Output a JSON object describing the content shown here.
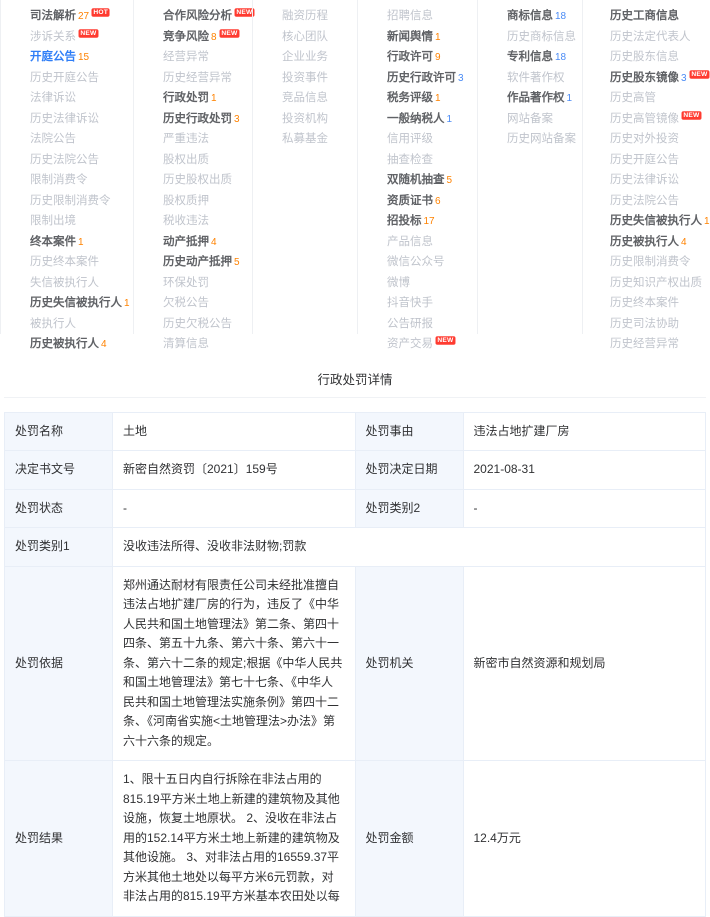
{
  "menu": {
    "columns": [
      {
        "id": "judicial",
        "items": [
          {
            "label": "司法解析",
            "count": "27",
            "count_color": "orange",
            "state": "active",
            "badge": "HOT"
          },
          {
            "label": "涉诉关系",
            "count": "",
            "state": "dim",
            "badge": "NEW"
          },
          {
            "label": "开庭公告",
            "count": "15",
            "count_color": "orange",
            "state": "selected",
            "badge": ""
          },
          {
            "label": "历史开庭公告",
            "count": "",
            "state": "dim",
            "badge": ""
          },
          {
            "label": "法律诉讼",
            "count": "",
            "state": "dim",
            "badge": ""
          },
          {
            "label": "历史法律诉讼",
            "count": "",
            "state": "dim",
            "badge": ""
          },
          {
            "label": "法院公告",
            "count": "",
            "state": "dim",
            "badge": ""
          },
          {
            "label": "历史法院公告",
            "count": "",
            "state": "dim",
            "badge": ""
          },
          {
            "label": "限制消费令",
            "count": "",
            "state": "dim",
            "badge": ""
          },
          {
            "label": "历史限制消费令",
            "count": "",
            "state": "dim",
            "badge": ""
          },
          {
            "label": "限制出境",
            "count": "",
            "state": "dim",
            "badge": ""
          },
          {
            "label": "终本案件",
            "count": "1",
            "count_color": "orange",
            "state": "active",
            "badge": ""
          },
          {
            "label": "历史终本案件",
            "count": "",
            "state": "dim",
            "badge": ""
          },
          {
            "label": "失信被执行人",
            "count": "",
            "state": "dim",
            "badge": ""
          },
          {
            "label": "历史失信被执行人",
            "count": "1",
            "count_color": "orange",
            "state": "active",
            "badge": ""
          },
          {
            "label": "被执行人",
            "count": "",
            "state": "dim",
            "badge": ""
          },
          {
            "label": "历史被执行人",
            "count": "4",
            "count_color": "orange",
            "state": "active",
            "badge": ""
          }
        ]
      },
      {
        "id": "risk",
        "items": [
          {
            "label": "合作风险分析",
            "count": "",
            "state": "active",
            "badge": "NEW"
          },
          {
            "label": "竞争风险",
            "count": "8",
            "count_color": "orange",
            "state": "active",
            "badge": "NEW"
          },
          {
            "label": "经营异常",
            "count": "",
            "state": "dim",
            "badge": ""
          },
          {
            "label": "历史经营异常",
            "count": "",
            "state": "dim",
            "badge": ""
          },
          {
            "label": "行政处罚",
            "count": "1",
            "count_color": "orange",
            "state": "active",
            "badge": ""
          },
          {
            "label": "历史行政处罚",
            "count": "3",
            "count_color": "orange",
            "state": "active",
            "badge": ""
          },
          {
            "label": "严重违法",
            "count": "",
            "state": "dim",
            "badge": ""
          },
          {
            "label": "股权出质",
            "count": "",
            "state": "dim",
            "badge": ""
          },
          {
            "label": "历史股权出质",
            "count": "",
            "state": "dim",
            "badge": ""
          },
          {
            "label": "股权质押",
            "count": "",
            "state": "dim",
            "badge": ""
          },
          {
            "label": "税收违法",
            "count": "",
            "state": "dim",
            "badge": ""
          },
          {
            "label": "动产抵押",
            "count": "4",
            "count_color": "orange",
            "state": "active",
            "badge": ""
          },
          {
            "label": "历史动产抵押",
            "count": "5",
            "count_color": "orange",
            "state": "active",
            "badge": ""
          },
          {
            "label": "环保处罚",
            "count": "",
            "state": "dim",
            "badge": ""
          },
          {
            "label": "欠税公告",
            "count": "",
            "state": "dim",
            "badge": ""
          },
          {
            "label": "历史欠税公告",
            "count": "",
            "state": "dim",
            "badge": ""
          },
          {
            "label": "清算信息",
            "count": "",
            "state": "dim",
            "badge": ""
          }
        ]
      },
      {
        "id": "investment",
        "items": [
          {
            "label": "融资历程",
            "count": "",
            "state": "dim",
            "badge": ""
          },
          {
            "label": "核心团队",
            "count": "",
            "state": "dim",
            "badge": ""
          },
          {
            "label": "企业业务",
            "count": "",
            "state": "dim",
            "badge": ""
          },
          {
            "label": "投资事件",
            "count": "",
            "state": "dim",
            "badge": ""
          },
          {
            "label": "竞品信息",
            "count": "",
            "state": "dim",
            "badge": ""
          },
          {
            "label": "投资机构",
            "count": "",
            "state": "dim",
            "badge": ""
          },
          {
            "label": "私募基金",
            "count": "",
            "state": "dim",
            "badge": ""
          }
        ]
      },
      {
        "id": "operation",
        "items": [
          {
            "label": "招聘信息",
            "count": "",
            "state": "dim",
            "badge": ""
          },
          {
            "label": "新闻舆情",
            "count": "1",
            "count_color": "orange",
            "state": "active",
            "badge": ""
          },
          {
            "label": "行政许可",
            "count": "9",
            "count_color": "orange",
            "state": "active",
            "badge": ""
          },
          {
            "label": "历史行政许可",
            "count": "3",
            "count_color": "blue",
            "state": "active",
            "badge": ""
          },
          {
            "label": "税务评级",
            "count": "1",
            "count_color": "orange",
            "state": "active",
            "badge": ""
          },
          {
            "label": "一般纳税人",
            "count": "1",
            "count_color": "blue",
            "state": "active",
            "badge": ""
          },
          {
            "label": "信用评级",
            "count": "",
            "state": "dim",
            "badge": ""
          },
          {
            "label": "抽查检查",
            "count": "",
            "state": "dim",
            "badge": ""
          },
          {
            "label": "双随机抽查",
            "count": "5",
            "count_color": "orange",
            "state": "active",
            "badge": ""
          },
          {
            "label": "资质证书",
            "count": "6",
            "count_color": "orange",
            "state": "active",
            "badge": ""
          },
          {
            "label": "招投标",
            "count": "17",
            "count_color": "orange",
            "state": "active",
            "badge": ""
          },
          {
            "label": "产品信息",
            "count": "",
            "state": "dim",
            "badge": ""
          },
          {
            "label": "微信公众号",
            "count": "",
            "state": "dim",
            "badge": ""
          },
          {
            "label": "微博",
            "count": "",
            "state": "dim",
            "badge": ""
          },
          {
            "label": "抖音快手",
            "count": "",
            "state": "dim",
            "badge": ""
          },
          {
            "label": "公告研报",
            "count": "",
            "state": "dim",
            "badge": ""
          },
          {
            "label": "资产交易",
            "count": "",
            "state": "dim",
            "badge": "NEW"
          }
        ]
      },
      {
        "id": "ip",
        "items": [
          {
            "label": "商标信息",
            "count": "18",
            "count_color": "blue",
            "state": "active",
            "badge": ""
          },
          {
            "label": "历史商标信息",
            "count": "",
            "state": "dim",
            "badge": ""
          },
          {
            "label": "专利信息",
            "count": "18",
            "count_color": "blue",
            "state": "active",
            "badge": ""
          },
          {
            "label": "软件著作权",
            "count": "",
            "state": "dim",
            "badge": ""
          },
          {
            "label": "作品著作权",
            "count": "1",
            "count_color": "blue",
            "state": "active",
            "badge": ""
          },
          {
            "label": "网站备案",
            "count": "",
            "state": "dim",
            "badge": ""
          },
          {
            "label": "历史网站备案",
            "count": "",
            "state": "dim",
            "badge": ""
          }
        ]
      },
      {
        "id": "history",
        "items": [
          {
            "label": "历史工商信息",
            "count": "",
            "state": "active",
            "badge": ""
          },
          {
            "label": "历史法定代表人",
            "count": "",
            "state": "dim",
            "badge": ""
          },
          {
            "label": "历史股东信息",
            "count": "",
            "state": "dim",
            "badge": ""
          },
          {
            "label": "历史股东镜像",
            "count": "3",
            "count_color": "blue",
            "state": "active",
            "badge": "NEW"
          },
          {
            "label": "历史高管",
            "count": "",
            "state": "dim",
            "badge": ""
          },
          {
            "label": "历史高管镜像",
            "count": "",
            "state": "dim",
            "badge": "NEW"
          },
          {
            "label": "历史对外投资",
            "count": "",
            "state": "dim",
            "badge": ""
          },
          {
            "label": "历史开庭公告",
            "count": "",
            "state": "dim",
            "badge": ""
          },
          {
            "label": "历史法律诉讼",
            "count": "",
            "state": "dim",
            "badge": ""
          },
          {
            "label": "历史法院公告",
            "count": "",
            "state": "dim",
            "badge": ""
          },
          {
            "label": "历史失信被执行人",
            "count": "1",
            "count_color": "orange",
            "state": "active",
            "badge": ""
          },
          {
            "label": "历史被执行人",
            "count": "4",
            "count_color": "orange",
            "state": "active",
            "badge": ""
          },
          {
            "label": "历史限制消费令",
            "count": "",
            "state": "dim",
            "badge": ""
          },
          {
            "label": "历史知识产权出质",
            "count": "",
            "state": "dim",
            "badge": ""
          },
          {
            "label": "历史终本案件",
            "count": "",
            "state": "dim",
            "badge": ""
          },
          {
            "label": "历史司法协助",
            "count": "",
            "state": "dim",
            "badge": ""
          },
          {
            "label": "历史经营异常",
            "count": "",
            "state": "dim",
            "badge": ""
          }
        ]
      }
    ]
  },
  "section": {
    "title": "行政处罚详情"
  },
  "detail": {
    "rows": [
      {
        "label_left": "处罚名称",
        "value_left": "土地",
        "label_right": "处罚事由",
        "value_right": "违法占地扩建厂房"
      },
      {
        "label_left": "决定书文号",
        "value_left": "新密自然资罚〔2021〕159号",
        "label_right": "处罚决定日期",
        "value_right": "2021-08-31"
      },
      {
        "label_left": "处罚状态",
        "value_left": "-",
        "label_right": "处罚类别2",
        "value_right": "-"
      },
      {
        "label_left": "处罚类别1",
        "value_left": "没收违法所得、没收非法财物;罚款",
        "label_right": "",
        "value_right": ""
      },
      {
        "label_left": "处罚依据",
        "value_left": "郑州通达耐材有限责任公司未经批准擅自违法占地扩建厂房的行为，违反了《中华人民共和国土地管理法》第二条、第四十四条、第五十九条、第六十条、第六十一条、第六十二条的规定;根据《中华人民共和国土地管理法》第七十七条、《中华人民共和国土地管理法实施条例》第四十二条、《河南省实施<土地管理法>办法》第六十六条的规定。",
        "label_right": "处罚机关",
        "value_right": "新密市自然资源和规划局"
      },
      {
        "label_left": "处罚结果",
        "value_left": "1、限十五日内自行拆除在非法占用的815.19平方米土地上新建的建筑物及其他设施，恢复土地原状。 2、没收在非法占用的152.14平方米土地上新建的建筑物及其他设施。 3、对非法占用的16559.37平方米其他土地处以每平方米6元罚款，对非法占用的815.19平方米基本农田处以每",
        "label_right": "处罚金额",
        "value_right": "12.4万元"
      }
    ]
  }
}
